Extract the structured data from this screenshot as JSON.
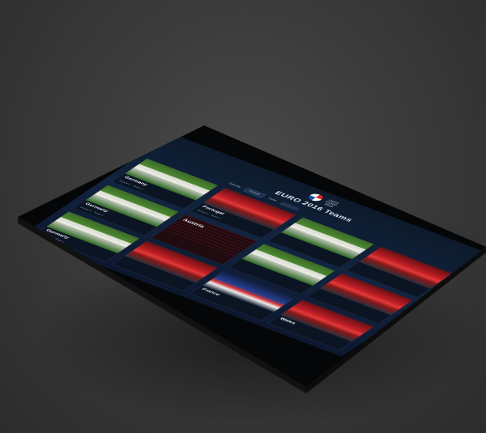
{
  "app": {
    "logo_text": "UEFA EURO 2016",
    "title": "EURO 2016 Teams"
  },
  "filters": {
    "sort_label": "Sort by",
    "sort_value": "Group",
    "view_label": "View",
    "search_placeholder": ""
  },
  "cards": [
    {
      "label": "Germany",
      "sub": "Group C · Team 1",
      "theme": "g"
    },
    {
      "label": "Portugal",
      "sub": "Group F · Team 2",
      "theme": "r"
    },
    {
      "label": "",
      "sub": "",
      "theme": "g"
    },
    {
      "label": "",
      "sub": "",
      "theme": "r"
    },
    {
      "label": "Germany",
      "sub": "Group C · Team 1",
      "theme": "g"
    },
    {
      "label": "Austria",
      "sub": "",
      "theme": "txt"
    },
    {
      "label": "",
      "sub": "",
      "theme": "g"
    },
    {
      "label": "",
      "sub": "",
      "theme": "r"
    },
    {
      "label": "Germany",
      "sub": "Group C · Team 1",
      "theme": "g"
    },
    {
      "label": "",
      "sub": "",
      "theme": "r"
    },
    {
      "label": "France",
      "sub": "",
      "theme": "f"
    },
    {
      "label": "Wales",
      "sub": "",
      "theme": "r"
    }
  ],
  "colors": {
    "background": "#3b3b3b",
    "screen": "#112440",
    "accent_red": "#c01f26",
    "pitch_green": "#4e8a2f"
  }
}
